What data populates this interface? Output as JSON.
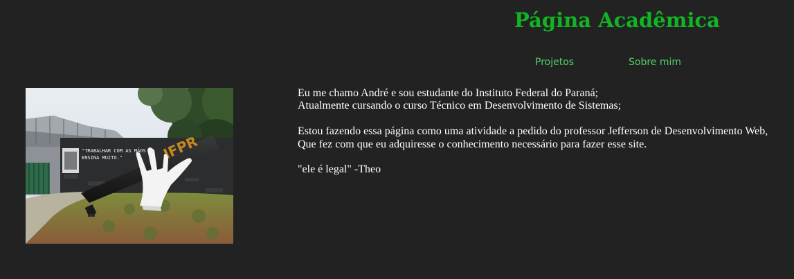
{
  "header": {
    "title": "Página Acadêmica"
  },
  "nav": {
    "items": [
      {
        "label": "Projetos"
      },
      {
        "label": "Sobre mim"
      }
    ]
  },
  "photo": {
    "sign_text_line1": "\"TRABALHAR COM AS MÃOS",
    "sign_text_line2": "ENSINA MUITO.\"",
    "monument_text": "IFPR"
  },
  "main": {
    "paragraphs": [
      {
        "lines": [
          "Eu me chamo André e sou estudante do Instituto Federal do Paraná;",
          "Atualmente cursando o curso Técnico em Desenvolvimento de Sistemas;"
        ]
      },
      {
        "lines": [
          "Estou fazendo essa página como uma atividade a pedido do professor Jefferson de Desenvolvimento Web,",
          "Que fez com que eu adquiresse o conhecimento necessário para fazer esse site."
        ]
      },
      {
        "lines": [
          "\"ele é legal\" -Theo"
        ]
      }
    ]
  },
  "colors": {
    "background": "#222222",
    "title": "#11b524",
    "nav_link": "#52d16a",
    "body_text": "#ffffff"
  }
}
